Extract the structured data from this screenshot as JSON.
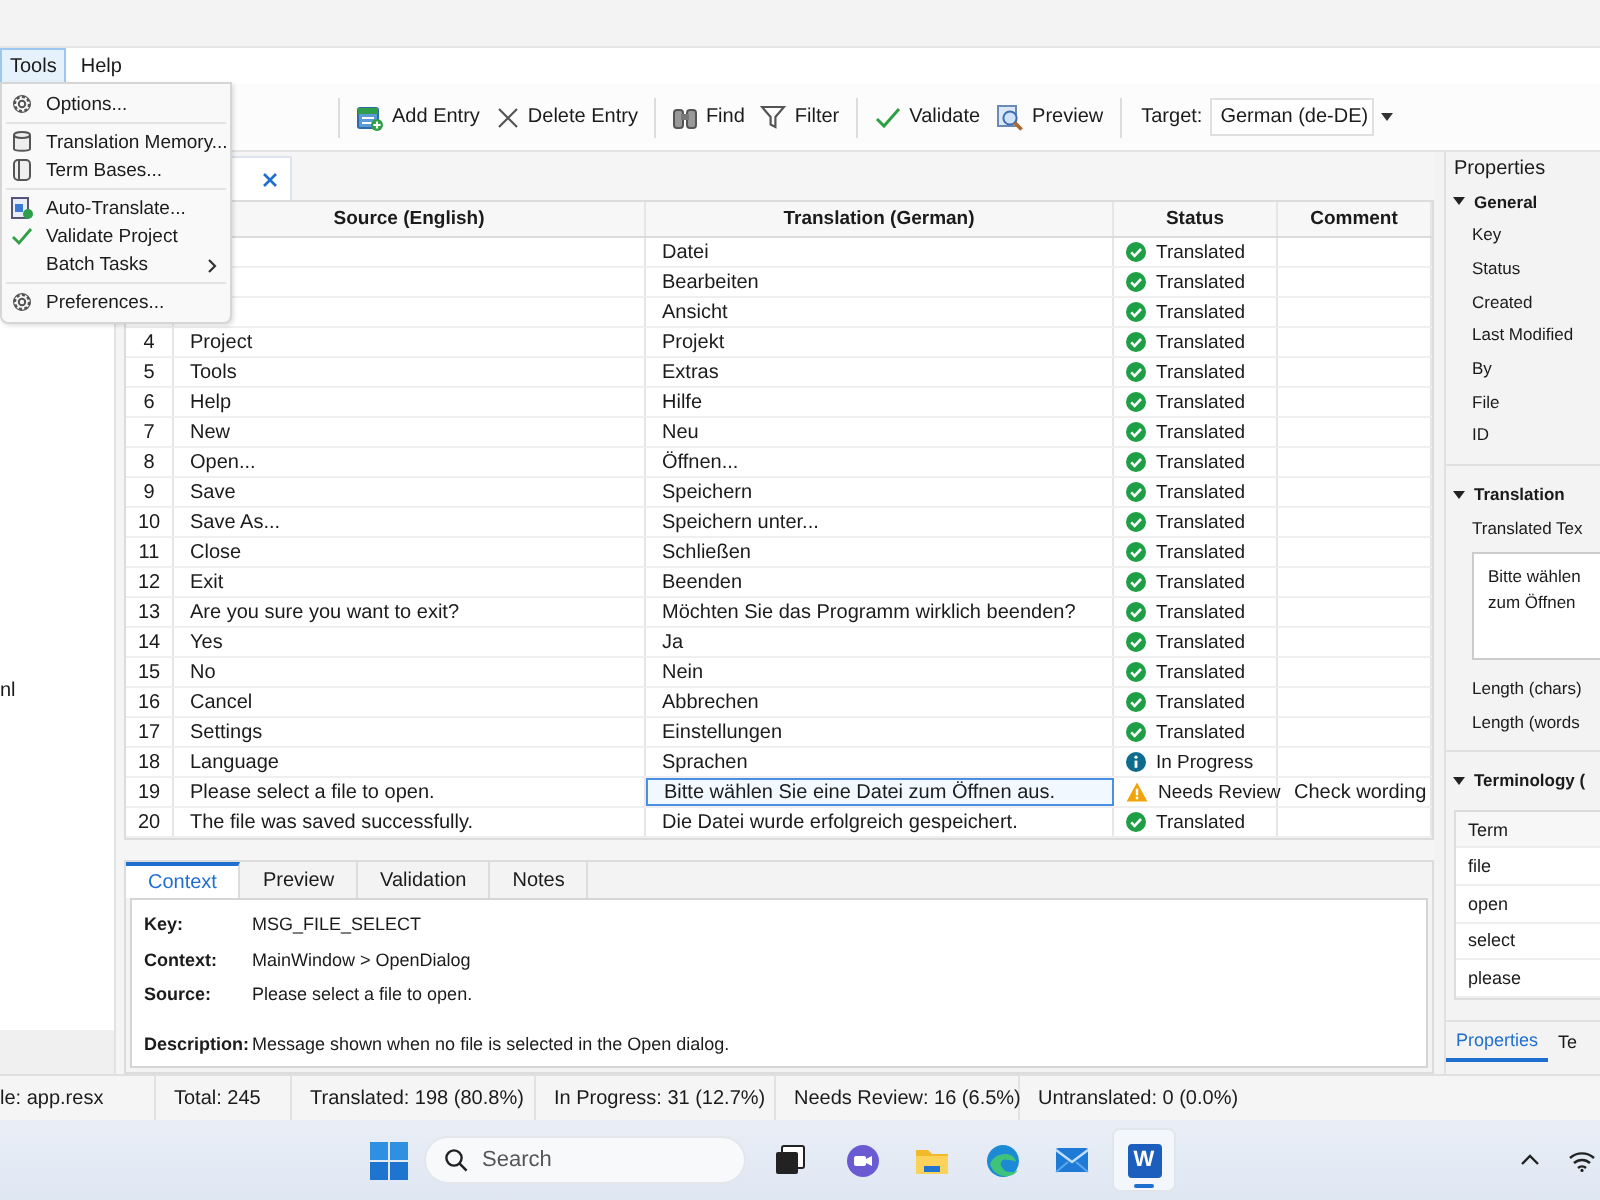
{
  "menu_bar": [
    {
      "label": "Tools",
      "selected": true
    },
    {
      "label": "Help",
      "selected": false
    }
  ],
  "tools_menu": [
    {
      "kind": "item",
      "label": "Options..."
    },
    {
      "kind": "separator"
    },
    {
      "kind": "item",
      "label": "Translation Memory..."
    },
    {
      "kind": "item",
      "label": "Term Bases..."
    },
    {
      "kind": "separator"
    },
    {
      "kind": "item",
      "label": "Auto-Translate..."
    },
    {
      "kind": "item",
      "label": "Validate Project"
    },
    {
      "kind": "submenu",
      "label": "Batch Tasks"
    },
    {
      "kind": "separator"
    },
    {
      "kind": "item",
      "label": "Preferences..."
    }
  ],
  "toolbar": {
    "buttons": [
      {
        "label": "Add Entry"
      },
      {
        "label": "Delete Entry"
      },
      {
        "label": "Find"
      },
      {
        "label": "Filter"
      },
      {
        "label": "Validate"
      },
      {
        "label": "Preview"
      }
    ],
    "target_label": "Target:",
    "target_value": "German (de-DE)"
  },
  "left_panel": {
    "text": "nl"
  },
  "table": {
    "columns": [
      "Source (English)",
      "Translation (German)",
      "Status",
      "Comment"
    ],
    "rows": [
      {
        "translation": "Datei",
        "status": "Translated",
        "kind": "ok",
        "selected": false
      },
      {
        "translation": "Bearbeiten",
        "status": "Translated",
        "kind": "ok",
        "selected": false
      },
      {
        "translation": "Ansicht",
        "status": "Translated",
        "kind": "ok",
        "selected": false
      },
      {
        "num": "4",
        "source": "Project",
        "translation": "Projekt",
        "status": "Translated",
        "kind": "ok",
        "selected": false
      },
      {
        "num": "5",
        "source": "Tools",
        "translation": "Extras",
        "status": "Translated",
        "kind": "ok",
        "selected": false
      },
      {
        "num": "6",
        "source": "Help",
        "translation": "Hilfe",
        "status": "Translated",
        "kind": "ok",
        "selected": false
      },
      {
        "num": "7",
        "source": "New",
        "translation": "Neu",
        "status": "Translated",
        "kind": "ok",
        "selected": false
      },
      {
        "num": "8",
        "source": "Open...",
        "translation": "Öffnen...",
        "status": "Translated",
        "kind": "ok",
        "selected": false
      },
      {
        "num": "9",
        "source": "Save",
        "translation": "Speichern",
        "status": "Translated",
        "kind": "ok",
        "selected": false
      },
      {
        "num": "10",
        "source": "Save As...",
        "translation": "Speichern unter...",
        "status": "Translated",
        "kind": "ok",
        "selected": false
      },
      {
        "num": "11",
        "source": "Close",
        "translation": "Schließen",
        "status": "Translated",
        "kind": "ok",
        "selected": false
      },
      {
        "num": "12",
        "source": "Exit",
        "translation": "Beenden",
        "status": "Translated",
        "kind": "ok",
        "selected": false
      },
      {
        "num": "13",
        "source": "Are you sure you want to exit?",
        "translation": "Möchten Sie das Programm wirklich beenden?",
        "status": "Translated",
        "kind": "ok",
        "selected": false
      },
      {
        "num": "14",
        "source": "Yes",
        "translation": "Ja",
        "status": "Translated",
        "kind": "ok",
        "selected": false
      },
      {
        "num": "15",
        "source": "No",
        "translation": "Nein",
        "status": "Translated",
        "kind": "ok",
        "selected": false
      },
      {
        "num": "16",
        "source": "Cancel",
        "translation": "Abbrechen",
        "status": "Translated",
        "kind": "ok",
        "selected": false
      },
      {
        "num": "17",
        "source": "Settings",
        "translation": "Einstellungen",
        "status": "Translated",
        "kind": "ok",
        "selected": false
      },
      {
        "num": "18",
        "source": "Language",
        "translation": "Sprachen",
        "status": "In Progress",
        "kind": "info",
        "selected": false
      },
      {
        "num": "19",
        "source": "Please select a file to open.",
        "translation": "Bitte wählen Sie eine Datei zum Öffnen aus.",
        "status": "Needs Review",
        "kind": "warning",
        "comment": "Check wording",
        "selected": true
      },
      {
        "num": "20",
        "source": "The file was saved successfully.",
        "translation": "Die Datei wurde erfolgreich gespeichert.",
        "status": "Translated",
        "kind": "ok",
        "selected": false
      }
    ]
  },
  "detail": {
    "tabs": [
      {
        "label": "Context",
        "selected": true
      },
      {
        "label": "Preview",
        "selected": false
      },
      {
        "label": "Validation",
        "selected": false
      },
      {
        "label": "Notes",
        "selected": false
      }
    ],
    "fields": [
      {
        "label": "Key:",
        "value": "MSG_FILE_SELECT"
      },
      {
        "label": "Context:",
        "value": "MainWindow > OpenDialog"
      },
      {
        "label": "Source:",
        "value": "Please select a file to open."
      },
      {
        "label": "Description:",
        "value": "Message shown when no file is selected in the Open dialog."
      }
    ]
  },
  "properties": {
    "title": "Properties",
    "groups": [
      {
        "kind": "fields",
        "title": "General",
        "expanded": true,
        "items": [
          "Key",
          "Status",
          "Created",
          "Last Modified",
          "By",
          "File",
          "ID"
        ]
      },
      {
        "kind": "text",
        "title": "Translation",
        "expanded": true,
        "label": "Translated Tex",
        "text_lines": [
          "Bitte wählen",
          "zum Öffnen"
        ],
        "items": [
          "Length (chars)",
          "Length (words"
        ]
      },
      {
        "kind": "terms",
        "title": "Terminology (",
        "expanded": true,
        "header": "Term",
        "items": [
          "file",
          "open",
          "select",
          "please"
        ]
      }
    ],
    "tabs": [
      {
        "label": "Properties",
        "selected": true
      },
      {
        "label": "Te",
        "selected": false
      }
    ]
  },
  "status_bar": [
    "le: app.resx",
    "Total: 245",
    "Translated: 198 (80.8%)",
    "In Progress: 31 (12.7%)",
    "Needs Review: 16 (6.5%)",
    "Untranslated: 0 (0.0%)"
  ],
  "taskbar": {
    "search_placeholder": "Search",
    "apps": [
      {
        "kind": "taskview",
        "active": false
      },
      {
        "kind": "chat",
        "active": false
      },
      {
        "kind": "folder",
        "active": false
      },
      {
        "kind": "browser",
        "active": false
      },
      {
        "kind": "mail",
        "active": false
      },
      {
        "kind": "writer",
        "label": "W",
        "active": true
      }
    ]
  }
}
